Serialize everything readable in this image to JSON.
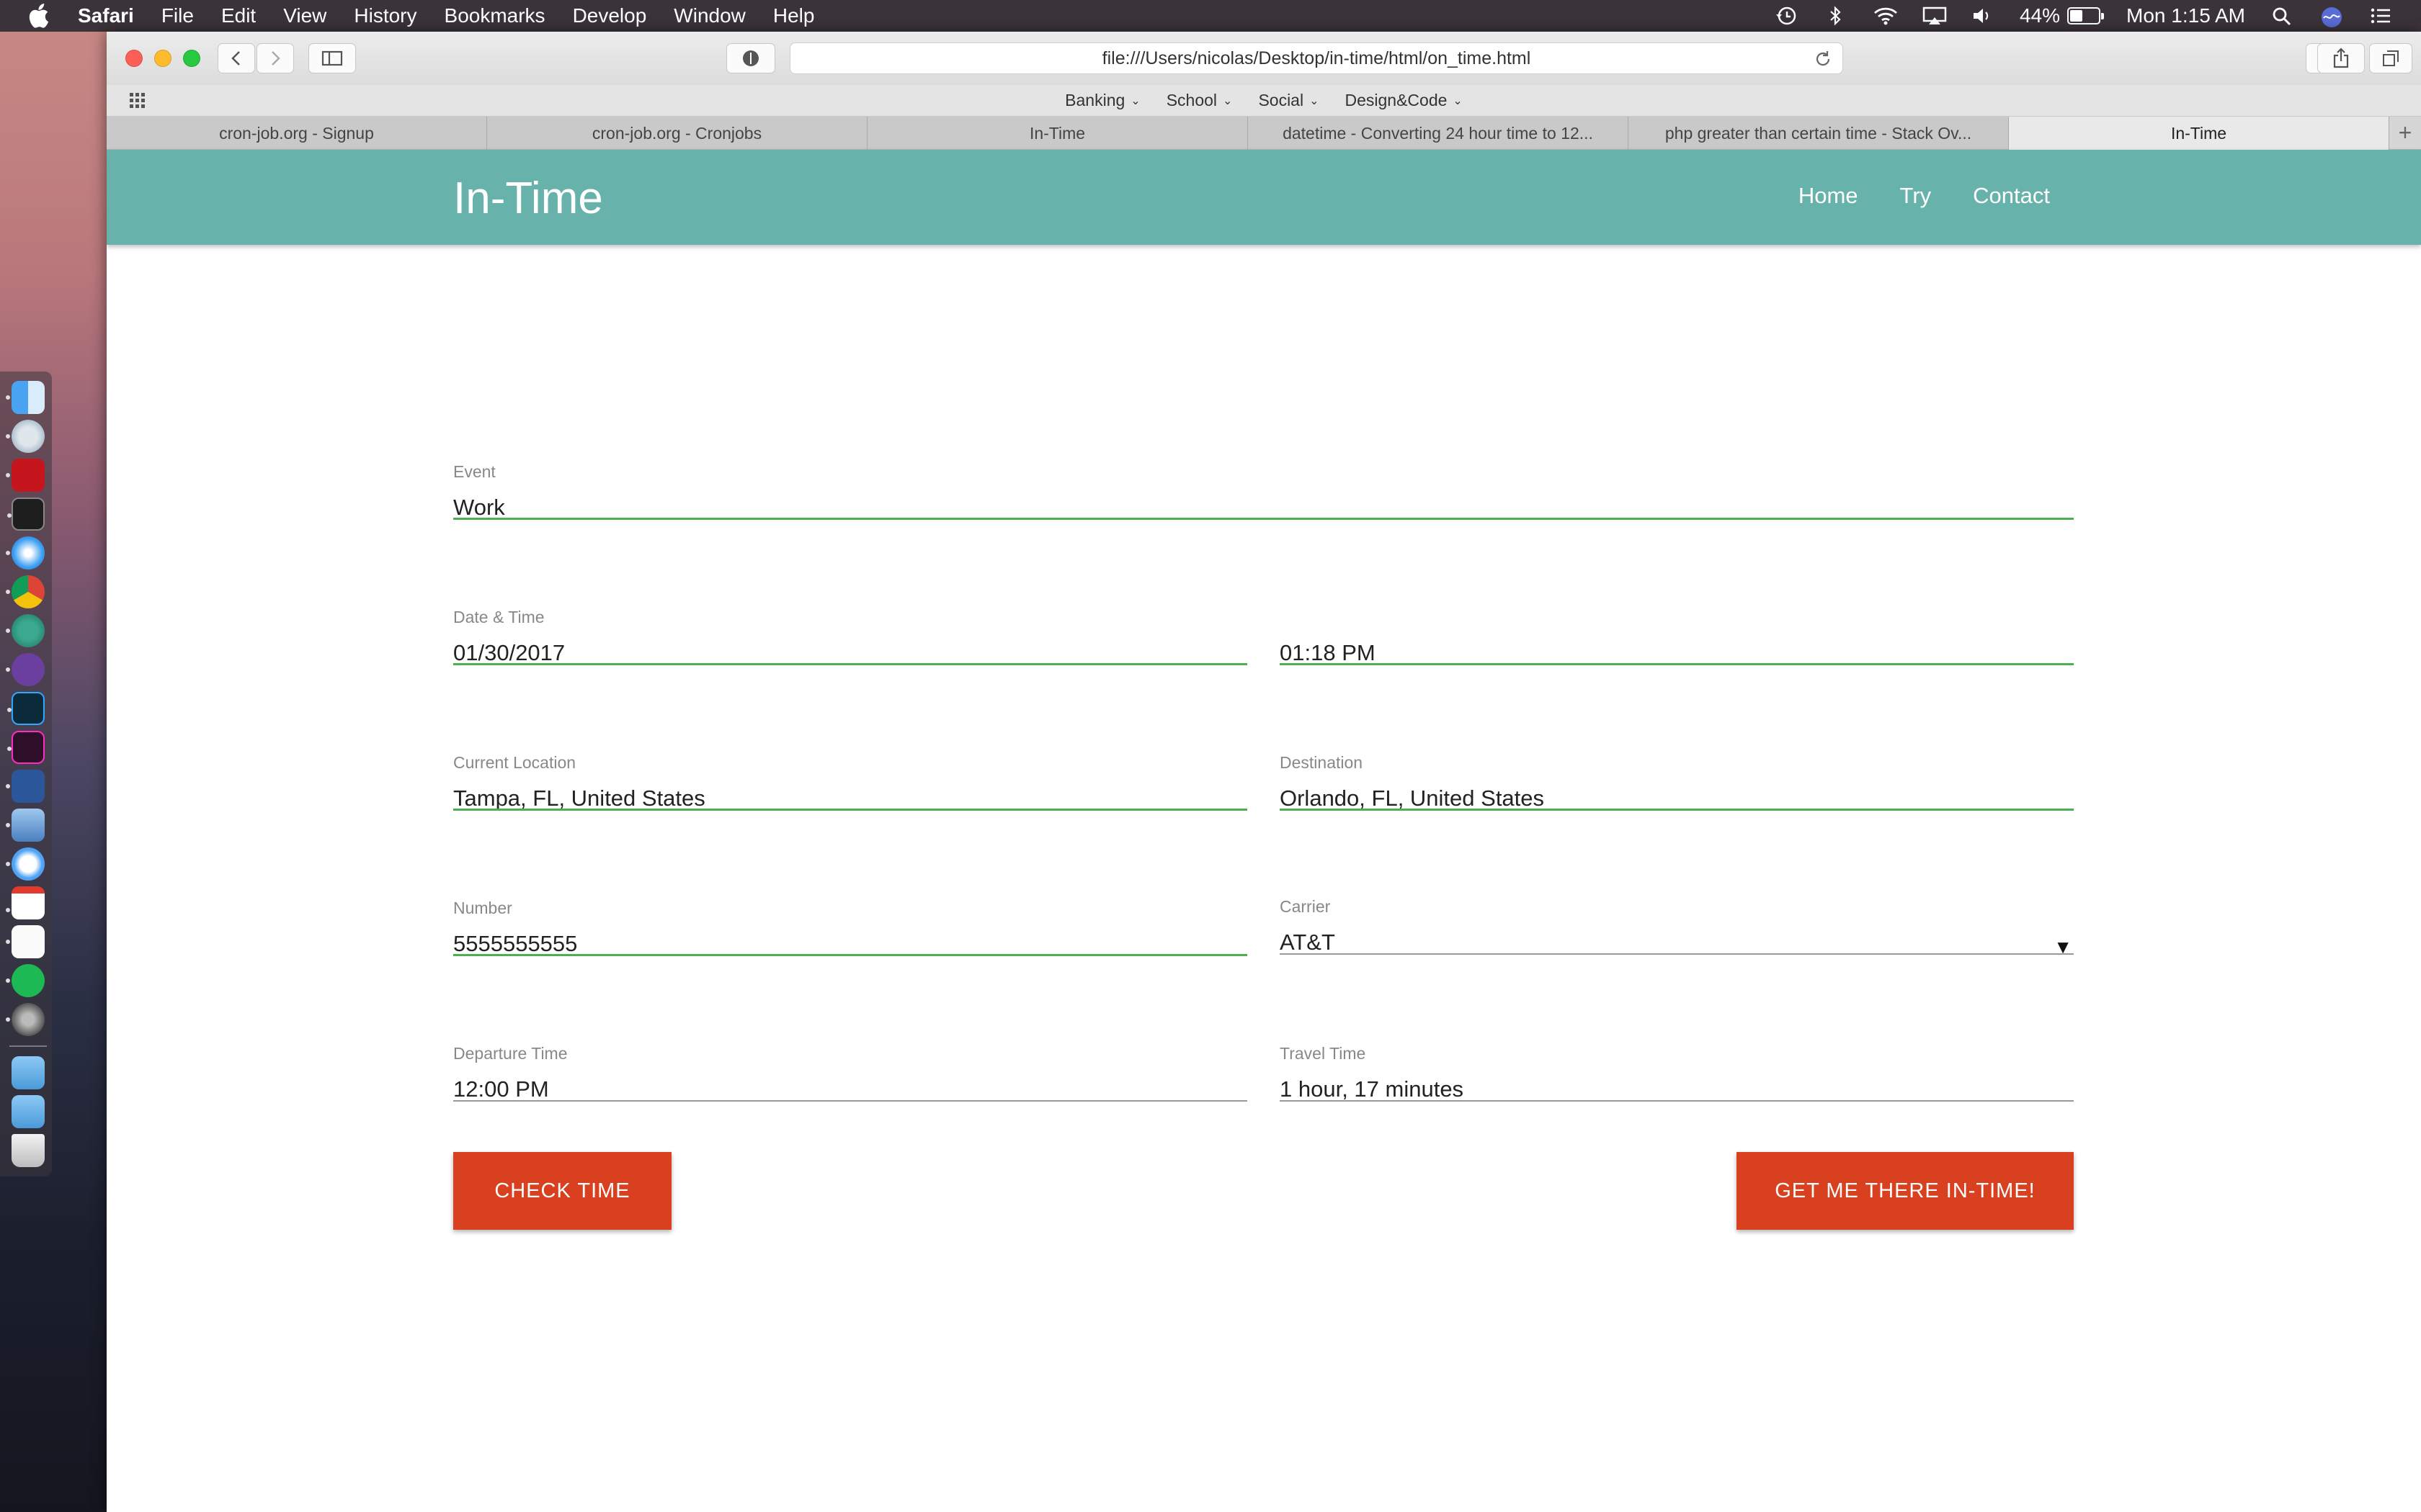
{
  "menubar": {
    "app": "Safari",
    "items": [
      "File",
      "Edit",
      "View",
      "History",
      "Bookmarks",
      "Develop",
      "Window",
      "Help"
    ],
    "battery_percent": "44%",
    "battery_level": 0.44,
    "clock": "Mon 1:15 AM"
  },
  "browser": {
    "url": "file:///Users/nicolas/Desktop/in-time/html/on_time.html",
    "bookmarks": [
      "Banking",
      "School",
      "Social",
      "Design&Code"
    ],
    "tabs": [
      {
        "title": "cron-job.org - Signup"
      },
      {
        "title": "cron-job.org - Cronjobs"
      },
      {
        "title": "In-Time"
      },
      {
        "title": "datetime - Converting 24 hour time to 12..."
      },
      {
        "title": "php greater than certain time - Stack Ov..."
      },
      {
        "title": "In-Time"
      }
    ]
  },
  "site": {
    "title": "In-Time",
    "nav": [
      "Home",
      "Try",
      "Contact"
    ]
  },
  "form": {
    "event": {
      "label": "Event",
      "value": "Work"
    },
    "date_time": {
      "label": "Date & Time",
      "date": "01/30/2017",
      "time": "01:18 PM"
    },
    "current_location": {
      "label": "Current Location",
      "value": "Tampa, FL, United States"
    },
    "destination": {
      "label": "Destination",
      "value": "Orlando, FL, United States"
    },
    "number": {
      "label": "Number",
      "value": "5555555555"
    },
    "carrier": {
      "label": "Carrier",
      "value": "AT&T"
    },
    "departure_time": {
      "label": "Departure Time",
      "value": "12:00 PM"
    },
    "travel_time": {
      "label": "Travel Time",
      "value": "1 hour, 17 minutes"
    },
    "check_button": "CHECK TIME",
    "submit_button": "GET ME THERE IN-TIME!"
  },
  "colors": {
    "header": "#67b3ab",
    "accent_line": "#4caf50",
    "button": "#d8401f"
  }
}
